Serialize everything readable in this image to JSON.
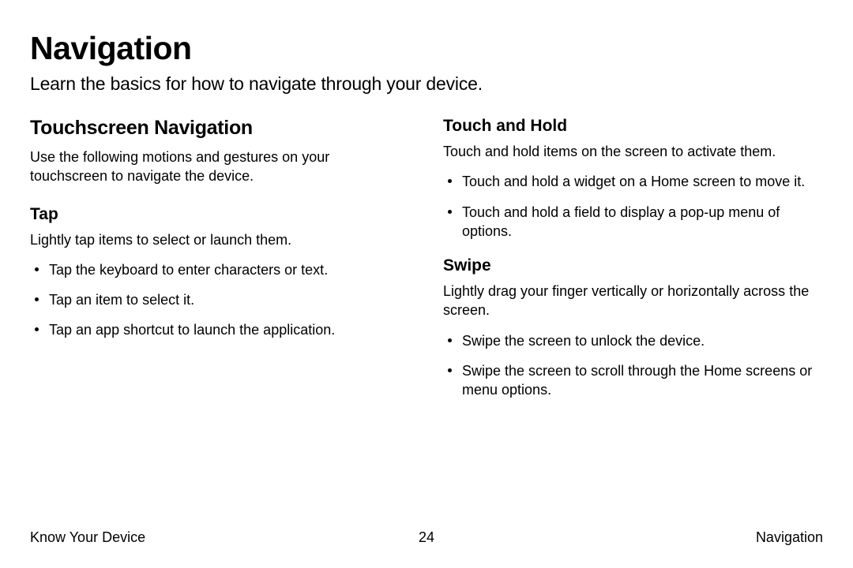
{
  "page_title": "Navigation",
  "subtitle": "Learn the basics for how to navigate through your device.",
  "left": {
    "heading": "Touchscreen Navigation",
    "intro": "Use the following motions and gestures on your touchscreen to navigate the device.",
    "sub1_heading": "Tap",
    "sub1_desc": "Lightly tap items to select or launch them.",
    "sub1_bullets": [
      "Tap the keyboard to enter characters or text.",
      "Tap an item to select it.",
      "Tap an app shortcut to launch the application."
    ]
  },
  "right": {
    "sub1_heading": "Touch and Hold",
    "sub1_desc": "Touch and hold items on the screen to activate them.",
    "sub1_bullets": [
      "Touch and hold a widget on a Home screen to move it.",
      "Touch and hold a field to display a pop-up menu of options."
    ],
    "sub2_heading": "Swipe",
    "sub2_desc": "Lightly drag your finger vertically or horizontally across the screen.",
    "sub2_bullets": [
      "Swipe the screen to unlock the device.",
      "Swipe the screen to scroll through the Home screens or menu options."
    ]
  },
  "footer": {
    "left": "Know Your Device",
    "center": "24",
    "right": "Navigation"
  }
}
